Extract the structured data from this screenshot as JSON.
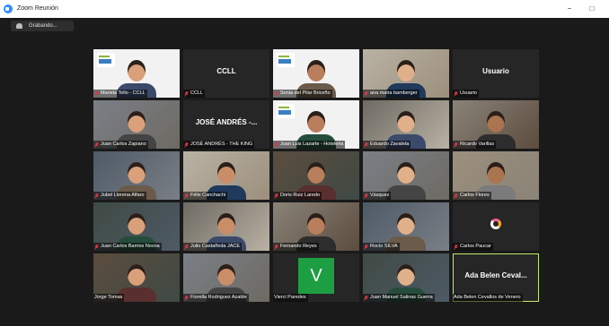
{
  "window": {
    "title": "Zoom Reunión",
    "minimize_glyph": "−",
    "maximize_glyph": "□",
    "app_icon": "zoom-camera-icon"
  },
  "recording": {
    "label": "Grabando..."
  },
  "colors": {
    "background": "#1a1a1a",
    "active_speaker_border": "#c7e86a",
    "muted_mic": "#e0384a",
    "avatar_v": "#1e9e43"
  },
  "tiles": [
    {
      "name": "Mariela Tello - CCLL",
      "type": "video",
      "row": 0,
      "col": 0
    },
    {
      "name": "CCLL",
      "type": "name",
      "display": "CCLL",
      "row": 0,
      "col": 1
    },
    {
      "name": "Sonia del Pilar Briceño",
      "type": "video",
      "row": 0,
      "col": 2
    },
    {
      "name": "ana maria bamberger",
      "type": "video",
      "row": 0,
      "col": 3
    },
    {
      "name": "Usuario",
      "type": "name",
      "display": "Usuario",
      "row": 0,
      "col": 4
    },
    {
      "name": "Juan Carlos Zapiano",
      "type": "video",
      "row": 1,
      "col": 0
    },
    {
      "name": "JOSÉ ANDRÉS - THE KING",
      "type": "name",
      "display": "JOSÉ ANDRÉS -...",
      "row": 1,
      "col": 1
    },
    {
      "name": "Juan Luis Lazarte - Hoteleria",
      "type": "video",
      "row": 1,
      "col": 2
    },
    {
      "name": "Eduardo Zavaleta",
      "type": "video",
      "row": 1,
      "col": 3
    },
    {
      "name": "Ricardo Varillas",
      "type": "video",
      "row": 1,
      "col": 4
    },
    {
      "name": "Jubel Llerena Alfaro",
      "type": "video",
      "row": 2,
      "col": 0
    },
    {
      "name": "Félix Canchachi",
      "type": "video",
      "row": 2,
      "col": 1
    },
    {
      "name": "Doris Ruiz Laredo",
      "type": "video",
      "row": 2,
      "col": 2
    },
    {
      "name": "Vásquez",
      "type": "video",
      "row": 2,
      "col": 3
    },
    {
      "name": "Carlos Flores",
      "type": "video",
      "row": 2,
      "col": 4
    },
    {
      "name": "Juan Carlos Barrios Novoa",
      "type": "video",
      "row": 3,
      "col": 0
    },
    {
      "name": "Julio Castañeda JACE",
      "type": "video",
      "row": 3,
      "col": 1
    },
    {
      "name": "Fernando Reyes",
      "type": "video",
      "row": 3,
      "col": 2
    },
    {
      "name": "Rocío SILVA",
      "type": "video",
      "row": 3,
      "col": 3
    },
    {
      "name": "Carlos Paucar",
      "type": "avatar",
      "row": 3,
      "col": 4
    },
    {
      "name": "Jorge Tomas",
      "type": "video",
      "row": 4,
      "col": 0
    },
    {
      "name": "Fiorella Rodriguez Azalde",
      "type": "video",
      "row": 4,
      "col": 1
    },
    {
      "name": "Vierci Paredes",
      "type": "letter",
      "letter": "V",
      "row": 4,
      "col": 2
    },
    {
      "name": "Juan Manuel Salinas Guerra",
      "type": "video",
      "row": 4,
      "col": 3
    },
    {
      "name": "Ada Belen Cevallos de Venero",
      "type": "name",
      "display": "Ada Belen Ceval...",
      "active": true,
      "row": 4,
      "col": 4
    }
  ]
}
